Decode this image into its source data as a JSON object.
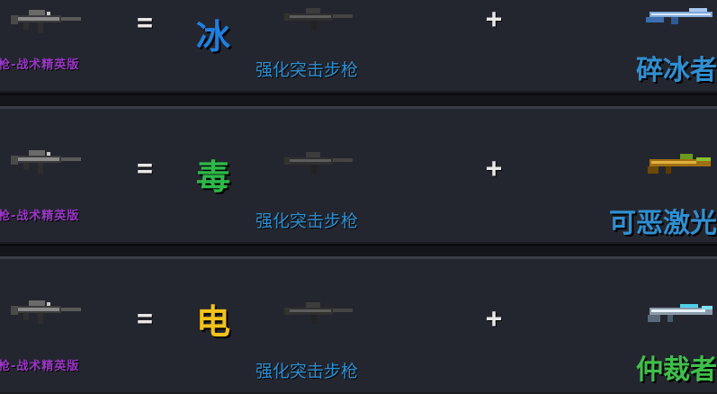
{
  "recipes": [
    {
      "result_name": "击步枪-战术精英版",
      "equals": "=",
      "element": "冰",
      "element_color": "#1f7fe0",
      "base_name": "强化突击步枪",
      "plus": "+",
      "ingredient_name": "碎冰者",
      "ingredient_color": "#2f8fd1",
      "ingredient_icon": "blue-ice-rifle-icon"
    },
    {
      "result_name": "击步枪-战术精英版",
      "equals": "=",
      "element": "毒",
      "element_color": "#2fb84a",
      "base_name": "强化突击步枪",
      "plus": "+",
      "ingredient_name": "可恶激光",
      "ingredient_color": "#2f8fd1",
      "ingredient_icon": "gold-laser-gun-icon"
    },
    {
      "result_name": "击步枪-战术精英版",
      "equals": "=",
      "element": "电",
      "element_color": "#f2c21a",
      "base_name": "强化突击步枪",
      "plus": "+",
      "ingredient_name": "仲裁者",
      "ingredient_color": "#3fbf4a",
      "ingredient_icon": "white-arbiter-rifle-icon"
    }
  ]
}
